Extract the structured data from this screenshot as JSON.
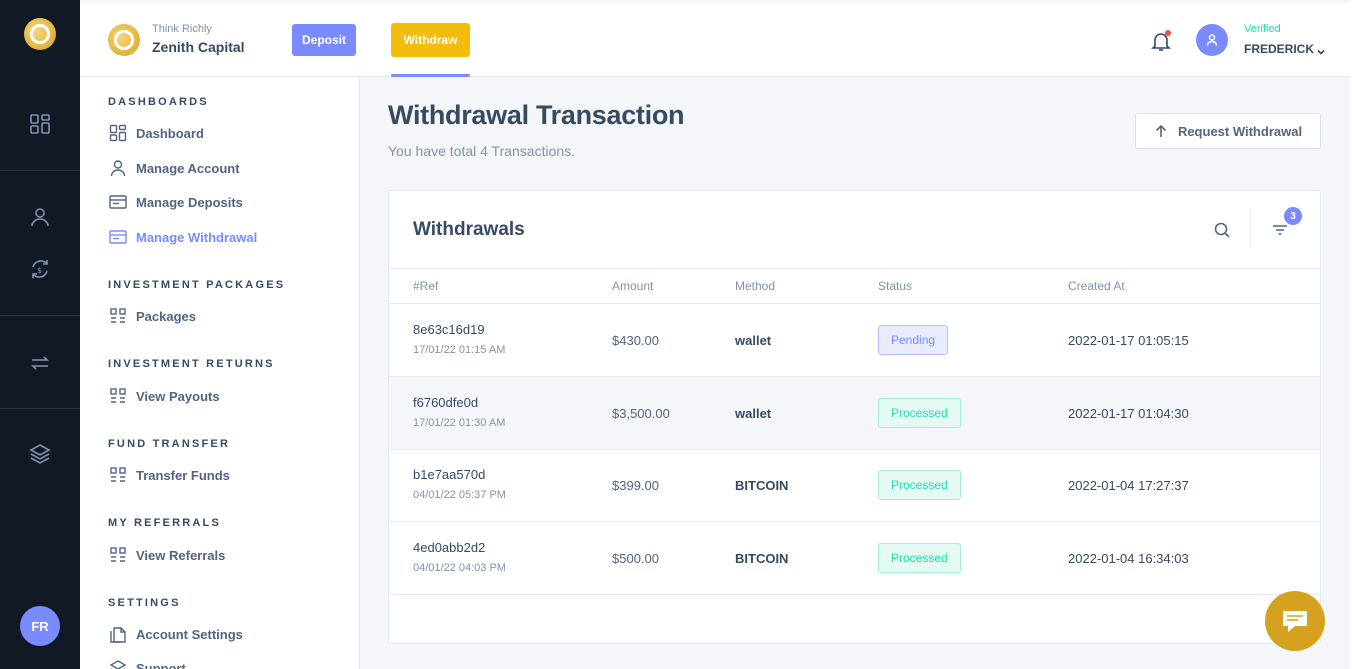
{
  "header": {
    "brand_tagline": "Think Richly",
    "brand_name": "Zenith Capital",
    "deposit_label": "Deposit",
    "withdraw_label": "Withdraw",
    "user_status": "Verified",
    "user_name": "FREDERICK"
  },
  "rail": {
    "avatar_initials": "FR",
    "icons": [
      "dashboard-grid-icon",
      "user-icon",
      "exchange-dollar-icon",
      "transfer-arrows-icon",
      "layers-icon"
    ]
  },
  "sidebar": {
    "sections": [
      {
        "title": "DASHBOARDS",
        "items": [
          {
            "label": "Dashboard",
            "icon": "dashboard-grid-icon"
          },
          {
            "label": "Manage Account",
            "icon": "user-icon"
          },
          {
            "label": "Manage Deposits",
            "icon": "card-icon"
          },
          {
            "label": "Manage Withdrawal",
            "icon": "card-icon",
            "active": true
          }
        ]
      },
      {
        "title": "INVESTMENT PACKAGES",
        "items": [
          {
            "label": "Packages",
            "icon": "grid-icon"
          }
        ]
      },
      {
        "title": "INVESTMENT RETURNS",
        "items": [
          {
            "label": "View Payouts",
            "icon": "grid-icon"
          }
        ]
      },
      {
        "title": "FUND TRANSFER",
        "items": [
          {
            "label": "Transfer Funds",
            "icon": "grid-icon"
          }
        ]
      },
      {
        "title": "MY REFERRALS",
        "items": [
          {
            "label": "View Referrals",
            "icon": "grid-icon"
          }
        ]
      },
      {
        "title": "SETTINGS",
        "items": [
          {
            "label": "Account Settings",
            "icon": "files-icon"
          },
          {
            "label": "Support",
            "icon": "layers-icon"
          }
        ]
      }
    ]
  },
  "main": {
    "title": "Withdrawal Transaction",
    "subtitle": "You have total 4 Transactions.",
    "request_button": "Request Withdrawal",
    "card_title": "Withdrawals",
    "filter_count": "3",
    "columns": [
      "#Ref",
      "Amount",
      "Method",
      "Status",
      "Created At"
    ],
    "rows": [
      {
        "ref": "8e63c16d19",
        "ref_date": "17/01/22 01:15 AM",
        "amount": "$430.00",
        "method": "wallet",
        "status": "Pending",
        "created": "2022-01-17 01:05:15"
      },
      {
        "ref": "f6760dfe0d",
        "ref_date": "17/01/22 01:30 AM",
        "amount": "$3,500.00",
        "method": "wallet",
        "status": "Processed",
        "created": "2022-01-17 01:04:30"
      },
      {
        "ref": "b1e7aa570d",
        "ref_date": "04/01/22 05:37 PM",
        "amount": "$399.00",
        "method": "BITCOIN",
        "status": "Processed",
        "created": "2022-01-04 17:27:37"
      },
      {
        "ref": "4ed0abb2d2",
        "ref_date": "04/01/22 04:03 PM",
        "amount": "$500.00",
        "method": "BITCOIN",
        "status": "Processed",
        "created": "2022-01-04 16:34:03"
      }
    ]
  },
  "colors": {
    "accent": "#798bff",
    "gold": "#f4bd0e",
    "success": "#1ee0ac",
    "rail_bg": "#101924"
  }
}
